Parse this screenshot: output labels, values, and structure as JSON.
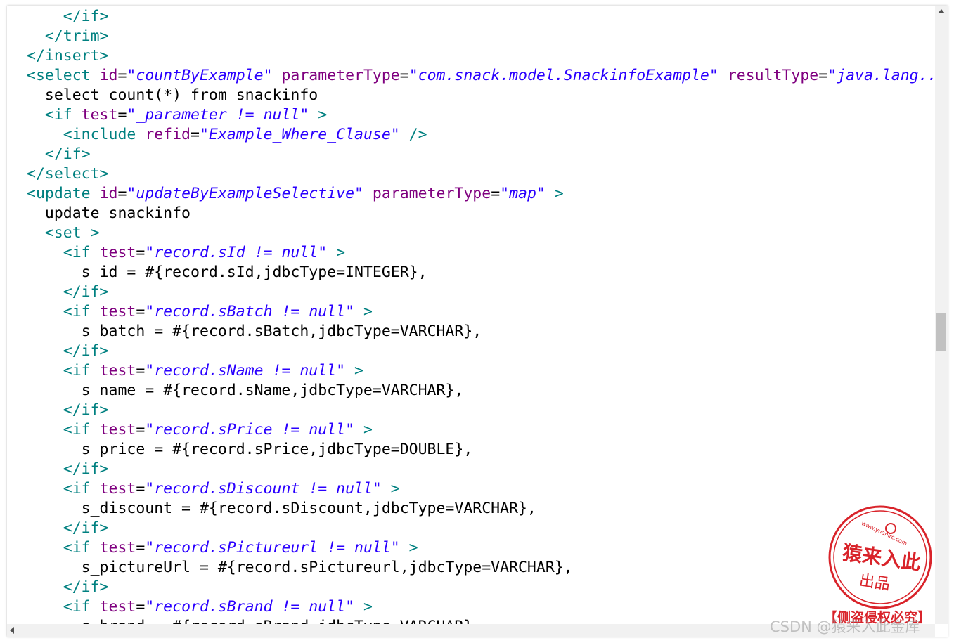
{
  "code": {
    "lines": [
      [
        {
          "k": "t",
          "s": "    </if>"
        }
      ],
      [
        {
          "k": "t",
          "s": "  </trim>"
        }
      ],
      [
        {
          "k": "t",
          "s": "</insert>"
        }
      ],
      [
        {
          "k": "t",
          "s": "<select "
        },
        {
          "k": "a",
          "s": "id"
        },
        {
          "k": "x",
          "s": "="
        },
        {
          "k": "v",
          "s": "\"countByExample\""
        },
        {
          "k": "x",
          "s": " "
        },
        {
          "k": "a",
          "s": "parameterType"
        },
        {
          "k": "x",
          "s": "="
        },
        {
          "k": "v",
          "s": "\"com.snack.model.SnackinfoExample\""
        },
        {
          "k": "x",
          "s": " "
        },
        {
          "k": "a",
          "s": "resultType"
        },
        {
          "k": "x",
          "s": "="
        },
        {
          "k": "v",
          "s": "\"java.lang.."
        }
      ],
      [
        {
          "k": "x",
          "s": "  select count(*) from snackinfo"
        }
      ],
      [
        {
          "k": "t",
          "s": "  <if "
        },
        {
          "k": "a",
          "s": "test"
        },
        {
          "k": "x",
          "s": "="
        },
        {
          "k": "v",
          "s": "\"_parameter != null\""
        },
        {
          "k": "t",
          "s": " >"
        }
      ],
      [
        {
          "k": "t",
          "s": "    <include "
        },
        {
          "k": "a",
          "s": "refid"
        },
        {
          "k": "x",
          "s": "="
        },
        {
          "k": "v",
          "s": "\"Example_Where_Clause\""
        },
        {
          "k": "t",
          "s": " />"
        }
      ],
      [
        {
          "k": "t",
          "s": "  </if>"
        }
      ],
      [
        {
          "k": "t",
          "s": "</select>"
        }
      ],
      [
        {
          "k": "t",
          "s": "<update "
        },
        {
          "k": "a",
          "s": "id"
        },
        {
          "k": "x",
          "s": "="
        },
        {
          "k": "v",
          "s": "\"updateByExampleSelective\""
        },
        {
          "k": "x",
          "s": " "
        },
        {
          "k": "a",
          "s": "parameterType"
        },
        {
          "k": "x",
          "s": "="
        },
        {
          "k": "v",
          "s": "\"map\""
        },
        {
          "k": "t",
          "s": " >"
        }
      ],
      [
        {
          "k": "x",
          "s": "  update snackinfo"
        }
      ],
      [
        {
          "k": "t",
          "s": "  <set >"
        }
      ],
      [
        {
          "k": "t",
          "s": "    <if "
        },
        {
          "k": "a",
          "s": "test"
        },
        {
          "k": "x",
          "s": "="
        },
        {
          "k": "v",
          "s": "\"record.sId != null\""
        },
        {
          "k": "t",
          "s": " >"
        }
      ],
      [
        {
          "k": "x",
          "s": "      s_id = #{record.sId,jdbcType=INTEGER},"
        }
      ],
      [
        {
          "k": "t",
          "s": "    </if>"
        }
      ],
      [
        {
          "k": "t",
          "s": "    <if "
        },
        {
          "k": "a",
          "s": "test"
        },
        {
          "k": "x",
          "s": "="
        },
        {
          "k": "v",
          "s": "\"record.sBatch != null\""
        },
        {
          "k": "t",
          "s": " >"
        }
      ],
      [
        {
          "k": "x",
          "s": "      s_batch = #{record.sBatch,jdbcType=VARCHAR},"
        }
      ],
      [
        {
          "k": "t",
          "s": "    </if>"
        }
      ],
      [
        {
          "k": "t",
          "s": "    <if "
        },
        {
          "k": "a",
          "s": "test"
        },
        {
          "k": "x",
          "s": "="
        },
        {
          "k": "v",
          "s": "\"record.sName != null\""
        },
        {
          "k": "t",
          "s": " >"
        }
      ],
      [
        {
          "k": "x",
          "s": "      s_name = #{record.sName,jdbcType=VARCHAR},"
        }
      ],
      [
        {
          "k": "t",
          "s": "    </if>"
        }
      ],
      [
        {
          "k": "t",
          "s": "    <if "
        },
        {
          "k": "a",
          "s": "test"
        },
        {
          "k": "x",
          "s": "="
        },
        {
          "k": "v",
          "s": "\"record.sPrice != null\""
        },
        {
          "k": "t",
          "s": " >"
        }
      ],
      [
        {
          "k": "x",
          "s": "      s_price = #{record.sPrice,jdbcType=DOUBLE},"
        }
      ],
      [
        {
          "k": "t",
          "s": "    </if>"
        }
      ],
      [
        {
          "k": "t",
          "s": "    <if "
        },
        {
          "k": "a",
          "s": "test"
        },
        {
          "k": "x",
          "s": "="
        },
        {
          "k": "v",
          "s": "\"record.sDiscount != null\""
        },
        {
          "k": "t",
          "s": " >"
        }
      ],
      [
        {
          "k": "x",
          "s": "      s_discount = #{record.sDiscount,jdbcType=VARCHAR},"
        }
      ],
      [
        {
          "k": "t",
          "s": "    </if>"
        }
      ],
      [
        {
          "k": "t",
          "s": "    <if "
        },
        {
          "k": "a",
          "s": "test"
        },
        {
          "k": "x",
          "s": "="
        },
        {
          "k": "v",
          "s": "\"record.sPictureurl != null\""
        },
        {
          "k": "t",
          "s": " >"
        }
      ],
      [
        {
          "k": "x",
          "s": "      s_pictureUrl = #{record.sPictureurl,jdbcType=VARCHAR},"
        }
      ],
      [
        {
          "k": "t",
          "s": "    </if>"
        }
      ],
      [
        {
          "k": "t",
          "s": "    <if "
        },
        {
          "k": "a",
          "s": "test"
        },
        {
          "k": "x",
          "s": "="
        },
        {
          "k": "v",
          "s": "\"record.sBrand != null\""
        },
        {
          "k": "t",
          "s": " >"
        }
      ],
      [
        {
          "k": "x",
          "s": "      s_brand = #{record.sBrand,jdbcType=VARCHAR},"
        }
      ]
    ]
  },
  "colors": {
    "tag": "#008080",
    "attribute": "#7f007f",
    "value": "#2a00ff",
    "text": "#000000",
    "stamp": "#d9232a"
  },
  "stamp": {
    "top_url": "www.yuanlrc.com",
    "main": "猿来入此",
    "sub": "出品",
    "banner": "【侧盗侵权必究】"
  },
  "watermark": "CSDN @猿来入此金库",
  "icons": {
    "scroll_up": "arrow-up-icon",
    "scroll_left": "arrow-left-icon"
  }
}
